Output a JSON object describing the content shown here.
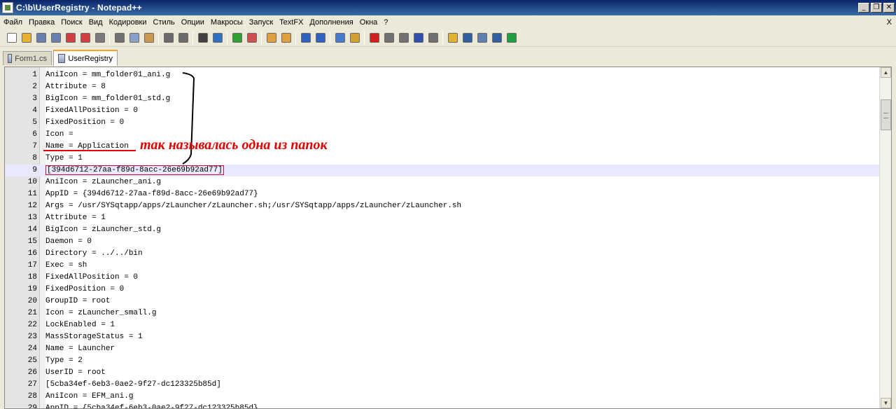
{
  "window": {
    "title": "C:\\b\\UserRegistry - Notepad++",
    "minimize": "_",
    "maximize": "❐",
    "close": "✕"
  },
  "menu": {
    "items": [
      "Файл",
      "Правка",
      "Поиск",
      "Вид",
      "Кодировки",
      "Стиль",
      "Опции",
      "Макросы",
      "Запуск",
      "TextFX",
      "Дополнения",
      "Окна",
      "?"
    ],
    "close_doc": "X"
  },
  "toolbar": {
    "icons": [
      {
        "name": "new-file-icon",
        "color": "#ffffff"
      },
      {
        "name": "open-file-icon",
        "color": "#e8b030"
      },
      {
        "name": "save-icon",
        "color": "#6a7fae"
      },
      {
        "name": "save-all-icon",
        "color": "#6a7fae"
      },
      {
        "name": "close-icon",
        "color": "#d04040"
      },
      {
        "name": "close-all-icon",
        "color": "#d04040"
      },
      {
        "name": "print-icon",
        "color": "#7a7a7a"
      },
      {
        "name": "sep"
      },
      {
        "name": "cut-icon",
        "color": "#707070"
      },
      {
        "name": "copy-icon",
        "color": "#8aa0c8"
      },
      {
        "name": "paste-icon",
        "color": "#c89a50"
      },
      {
        "name": "sep"
      },
      {
        "name": "undo-icon",
        "color": "#6a6a6a"
      },
      {
        "name": "redo-icon",
        "color": "#6a6a6a"
      },
      {
        "name": "sep"
      },
      {
        "name": "find-icon",
        "color": "#404040"
      },
      {
        "name": "replace-icon",
        "color": "#3070c0"
      },
      {
        "name": "sep"
      },
      {
        "name": "zoom-in-icon",
        "color": "#30a030"
      },
      {
        "name": "zoom-out-icon",
        "color": "#d05050"
      },
      {
        "name": "sep"
      },
      {
        "name": "sync-vertical-icon",
        "color": "#e0a040"
      },
      {
        "name": "sync-horizontal-icon",
        "color": "#e0a040"
      },
      {
        "name": "sep"
      },
      {
        "name": "word-wrap-icon",
        "color": "#3060c0"
      },
      {
        "name": "show-all-chars-icon",
        "color": "#3060c0"
      },
      {
        "name": "sep"
      },
      {
        "name": "indent-guide-icon",
        "color": "#4a7ad0"
      },
      {
        "name": "user-lang-icon",
        "color": "#d0a030"
      },
      {
        "name": "sep"
      },
      {
        "name": "record-macro-icon",
        "color": "#d02020"
      },
      {
        "name": "stop-record-icon",
        "color": "#707070"
      },
      {
        "name": "playback-icon",
        "color": "#707070"
      },
      {
        "name": "run-multiple-icon",
        "color": "#3050b0"
      },
      {
        "name": "save-macro-icon",
        "color": "#707070"
      },
      {
        "name": "sep"
      },
      {
        "name": "open-folder-icon",
        "color": "#e0b030"
      },
      {
        "name": "console-icon",
        "color": "#3060a0"
      },
      {
        "name": "doc-map-icon",
        "color": "#6080b0"
      },
      {
        "name": "spell-abc-icon",
        "color": "#3060a0"
      },
      {
        "name": "spell-check-icon",
        "color": "#20a040"
      }
    ]
  },
  "tabs": [
    {
      "label": "Form1.cs",
      "active": false
    },
    {
      "label": "UserRegistry",
      "active": true
    }
  ],
  "editor": {
    "current_line": 9,
    "lines": [
      {
        "n": "1",
        "text": "AniIcon = mm_folder01_ani.g"
      },
      {
        "n": "2",
        "text": "Attribute = 8"
      },
      {
        "n": "3",
        "text": "BigIcon = mm_folder01_std.g"
      },
      {
        "n": "4",
        "text": "FixedAllPosition = 0"
      },
      {
        "n": "5",
        "text": "FixedPosition = 0"
      },
      {
        "n": "6",
        "text": "Icon ="
      },
      {
        "n": "7",
        "text": "Name = Application"
      },
      {
        "n": "8",
        "text": "Type = 1"
      },
      {
        "n": "9",
        "text": "[394d6712-27aa-f89d-8acc-26e69b92ad77]"
      },
      {
        "n": "10",
        "text": "AniIcon = zLauncher_ani.g"
      },
      {
        "n": "11",
        "text": "AppID = {394d6712-27aa-f89d-8acc-26e69b92ad77}"
      },
      {
        "n": "12",
        "text": "Args = /usr/SYSqtapp/apps/zLauncher/zLauncher.sh;/usr/SYSqtapp/apps/zLauncher/zLauncher.sh"
      },
      {
        "n": "13",
        "text": "Attribute = 1"
      },
      {
        "n": "14",
        "text": "BigIcon = zLauncher_std.g"
      },
      {
        "n": "15",
        "text": "Daemon = 0"
      },
      {
        "n": "16",
        "text": "Directory = ../../bin"
      },
      {
        "n": "17",
        "text": "Exec = sh"
      },
      {
        "n": "18",
        "text": "FixedAllPosition = 0"
      },
      {
        "n": "19",
        "text": "FixedPosition = 0"
      },
      {
        "n": "20",
        "text": "GroupID = root"
      },
      {
        "n": "21",
        "text": "Icon = zLauncher_small.g"
      },
      {
        "n": "22",
        "text": "LockEnabled = 1"
      },
      {
        "n": "23",
        "text": "MassStorageStatus = 1"
      },
      {
        "n": "24",
        "text": "Name = Launcher"
      },
      {
        "n": "25",
        "text": "Type = 2"
      },
      {
        "n": "26",
        "text": "UserID = root"
      },
      {
        "n": "27",
        "text": "[5cba34ef-6eb3-0ae2-9f27-dc123325b85d]"
      },
      {
        "n": "28",
        "text": "AniIcon = EFM_ani.g"
      },
      {
        "n": "29",
        "text": "AppID = {5cba34ef-6eb3-0ae2-9f27-dc123325b85d}"
      }
    ]
  },
  "annotation": {
    "text": "так называлась одна из папок",
    "color": "#e00000"
  }
}
